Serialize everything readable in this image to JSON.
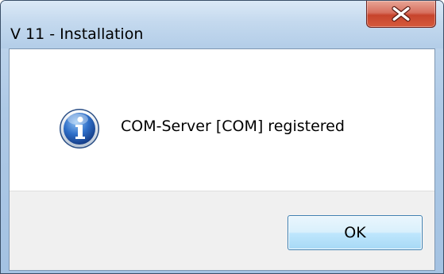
{
  "window": {
    "title": "V 11 - Installation",
    "close_icon": "close-icon"
  },
  "message": {
    "icon": "info-icon",
    "text": "COM-Server [COM] registered"
  },
  "buttons": {
    "ok_label": "OK"
  },
  "colors": {
    "close_button": "#c7442c",
    "info_icon": "#1f5db5",
    "button_area": "#f0f0f0"
  }
}
